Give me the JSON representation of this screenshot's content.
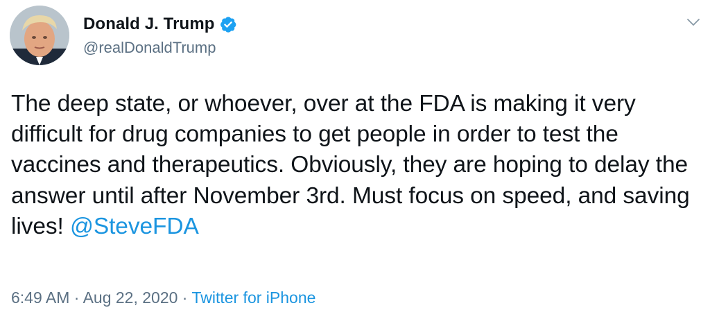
{
  "author": {
    "name": "Donald J. Trump",
    "handle": "@realDonaldTrump",
    "verified": true,
    "verified_icon": "verified-badge-icon"
  },
  "menu_icon": "chevron-down-icon",
  "tweet": {
    "text": "The deep state, or whoever, over at the FDA is making it very difficult for drug companies to get people in order to test the vaccines and therapeutics. Obviously, they are hoping to delay the answer until after November 3rd. Must focus on speed, and saving lives!",
    "mention": "@SteveFDA"
  },
  "meta": {
    "time": "6:49 AM",
    "separator_1": " · ",
    "date": "Aug 22, 2020",
    "separator_2": " · ",
    "source": "Twitter for iPhone"
  },
  "colors": {
    "link": "#1b95e0",
    "secondary_text": "#5b7083",
    "primary_text": "#0f1419",
    "verified_badge": "#1da1f2"
  }
}
